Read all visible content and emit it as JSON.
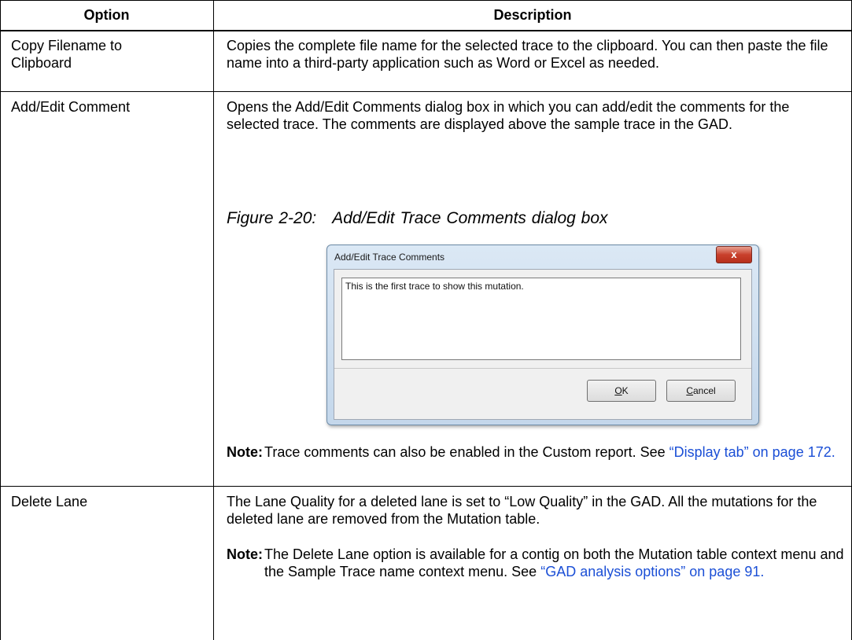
{
  "table": {
    "headers": {
      "option": "Option",
      "description": "Description"
    },
    "rows": [
      {
        "option": "Copy Filename to Clipboard",
        "description": "Copies the complete file name for the selected trace to the clipboard. You can then paste the file name into a third-party application such as Word or Excel as needed."
      },
      {
        "option": "Add/Edit Comment",
        "description": "Opens the Add/Edit Comments dialog box in which you can add/edit the comments for the selected trace. The comments are displayed above the sample trace in the GAD.",
        "figure": {
          "number": "Figure 2-20:",
          "title": "Add/Edit Trace Comments dialog box",
          "dialog": {
            "title": "Add/Edit Trace Comments",
            "close_glyph": "x",
            "comment_text": "This is the first trace to show this mutation.",
            "ok_label": {
              "mnemonic": "O",
              "rest": "K"
            },
            "cancel_label": {
              "mnemonic": "C",
              "rest": "ancel"
            }
          }
        },
        "note": {
          "label": "Note:",
          "text": "Trace comments can also be enabled in the Custom report. See ",
          "link": "“Display tab” on page 172."
        }
      },
      {
        "option": "Delete Lane",
        "description": "The Lane Quality for a deleted lane is set to “Low Quality” in the GAD. All the mutations for the deleted lane are removed from the Mutation table.",
        "note": {
          "label": "Note:",
          "text": "The Delete Lane option is available for a contig on both the Mutation table context menu and the Sample Trace name context menu. See ",
          "link": "“GAD analysis options” on page 91."
        }
      }
    ]
  }
}
